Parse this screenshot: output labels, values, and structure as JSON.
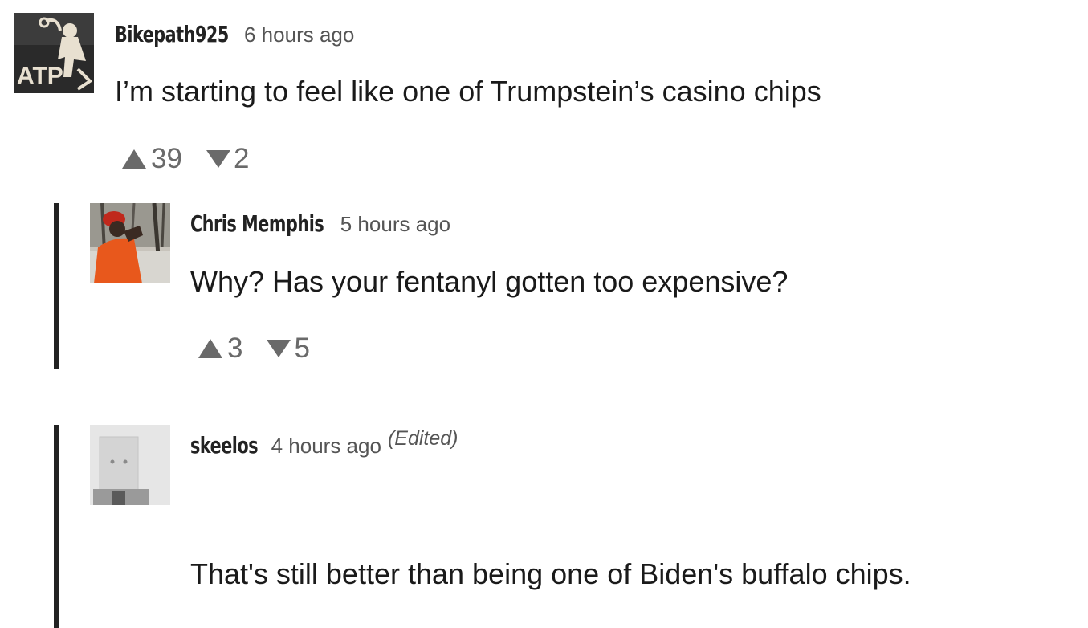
{
  "comments": [
    {
      "author": "Bikepath925",
      "time": "6 hours ago",
      "body": "I’m starting to feel like one of Trumpstein’s casino chips",
      "upvotes": "39",
      "downvotes": "2",
      "avatar_icon": "atp-logo-avatar",
      "avatar_text": "ATP"
    },
    {
      "author": "Chris Memphis",
      "time": "5 hours ago",
      "body": "Why? Has your fentanyl gotten too expensive?",
      "upvotes": "3",
      "downvotes": "5",
      "avatar_icon": "hunter-photo-avatar"
    },
    {
      "author": "skeelos",
      "time": "4 hours ago",
      "edited": "(Edited)",
      "body": "That's still better than being one of Biden's buffalo chips.",
      "avatar_icon": "paper-bag-head-avatar"
    }
  ],
  "colors": {
    "text": "#1a1a1a",
    "meta": "#555555",
    "votes": "#6a6a6a",
    "thread_bar": "#222222"
  }
}
